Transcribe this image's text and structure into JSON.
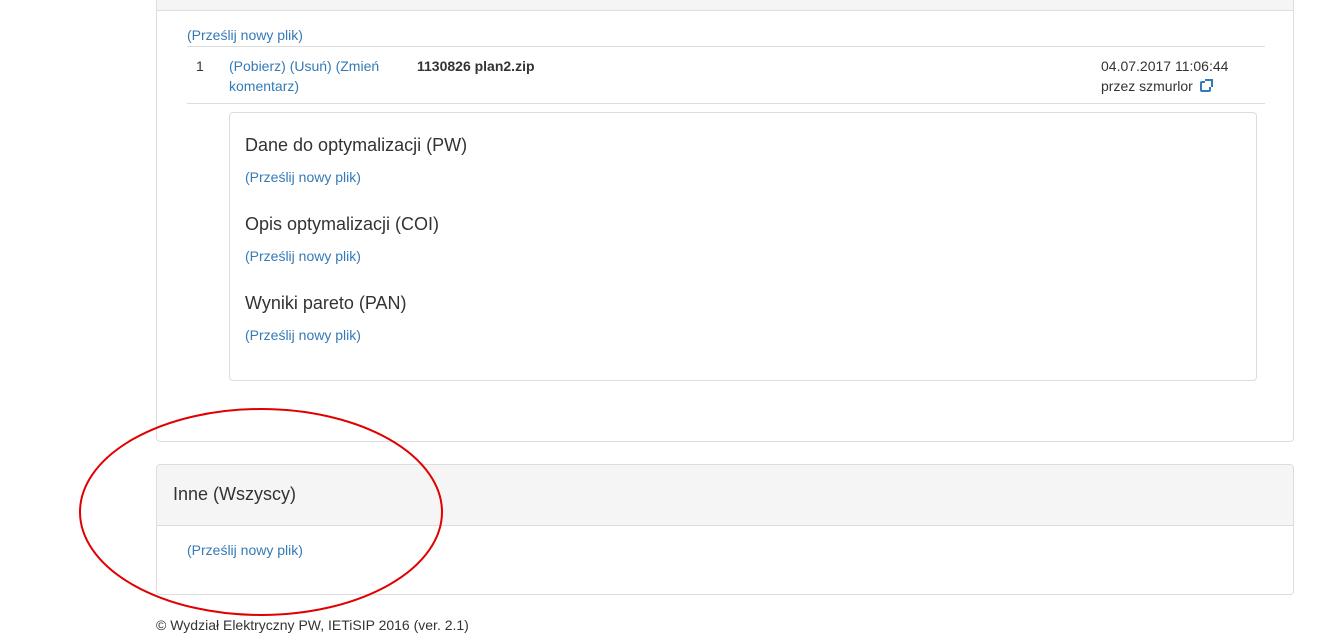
{
  "upper_panel": {
    "upload_link": "(Prześlij nowy plik)",
    "files": [
      {
        "number": "1",
        "download": "(Pobierz)",
        "delete": "(Usuń)",
        "change_comment_line1": "(Zmień",
        "change_comment_line2": "komentarz)",
        "filename": "1130826 plan2.zip",
        "date": "04.07.2017 11:06:44",
        "author_prefix": "przez szmurlor",
        "author_icon": "external-link-icon"
      }
    ],
    "sections": [
      {
        "title": "Dane do optymalizacji (PW)",
        "upload_link": "(Prześlij nowy plik)"
      },
      {
        "title": "Opis optymalizacji (COI)",
        "upload_link": "(Prześlij nowy plik)"
      },
      {
        "title": "Wyniki pareto (PAN)",
        "upload_link": "(Prześlij nowy plik)"
      }
    ]
  },
  "lower_panel": {
    "title": "Inne (Wszyscy)",
    "upload_link": "(Prześlij nowy plik)"
  },
  "footer": {
    "text": "© Wydział Elektryczny PW, IETiSIP 2016 (ver. 2.1)"
  },
  "annotation": {
    "color": "#e00000",
    "shape": "ellipse"
  },
  "colors": {
    "link": "#337ab7",
    "panel_header": "#f5f5f5",
    "border": "#dddddd"
  }
}
